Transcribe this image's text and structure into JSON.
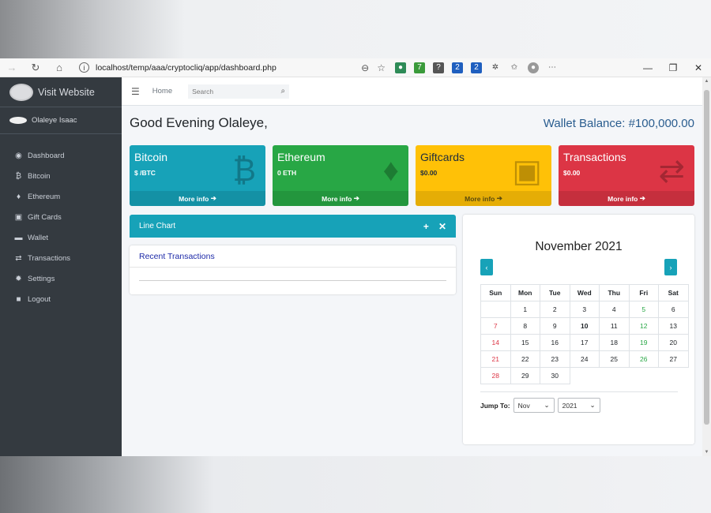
{
  "browser": {
    "url": "localhost/temp/aaa/cryptocliq/app/dashboard.php",
    "ext_badges": [
      "7",
      "2",
      "2"
    ]
  },
  "sidebar": {
    "brand": "Visit Website",
    "user": "Olaleye Isaac",
    "items": [
      {
        "label": "Dashboard",
        "icon": "dashboard-icon"
      },
      {
        "label": "Bitcoin",
        "icon": "bitcoin-icon"
      },
      {
        "label": "Ethereum",
        "icon": "ethereum-icon"
      },
      {
        "label": "Gift Cards",
        "icon": "gift-icon"
      },
      {
        "label": "Wallet",
        "icon": "wallet-icon"
      },
      {
        "label": "Transactions",
        "icon": "transfer-icon"
      },
      {
        "label": "Settings",
        "icon": "gear-icon"
      },
      {
        "label": "Logout",
        "icon": "lock-icon"
      }
    ]
  },
  "topnav": {
    "home": "Home",
    "search_placeholder": "Search"
  },
  "greeting": "Good Evening Olaleye,",
  "wallet_balance": "Wallet Balance: #100,000.00",
  "cards": [
    {
      "title": "Bitcoin",
      "value": "$ /BTC",
      "more": "More info",
      "color": "#17a2b8"
    },
    {
      "title": "Ethereum",
      "value": "0 ETH",
      "more": "More info",
      "color": "#28a745"
    },
    {
      "title": "Giftcards",
      "value": "$0.00",
      "more": "More info",
      "color": "#ffc107"
    },
    {
      "title": "Transactions",
      "value": "$0.00",
      "more": "More info",
      "color": "#dc3545"
    }
  ],
  "line_chart": {
    "title": "Line Chart"
  },
  "recent": {
    "title": "Recent Transactions"
  },
  "calendar": {
    "title": "November 2021",
    "prev": "‹",
    "next": "›",
    "days": [
      "Sun",
      "Mon",
      "Tue",
      "Wed",
      "Thu",
      "Fri",
      "Sat"
    ],
    "weeks": [
      [
        "",
        "1",
        "2",
        "3",
        "4",
        "5",
        "6"
      ],
      [
        "7",
        "8",
        "9",
        "10",
        "11",
        "12",
        "13"
      ],
      [
        "14",
        "15",
        "16",
        "17",
        "18",
        "19",
        "20"
      ],
      [
        "21",
        "22",
        "23",
        "24",
        "25",
        "26",
        "27"
      ],
      [
        "28",
        "29",
        "30",
        "",
        "",
        "",
        ""
      ]
    ],
    "today": "10",
    "jump_label": "Jump To:",
    "month_select": "Nov",
    "year_select": "2021"
  }
}
